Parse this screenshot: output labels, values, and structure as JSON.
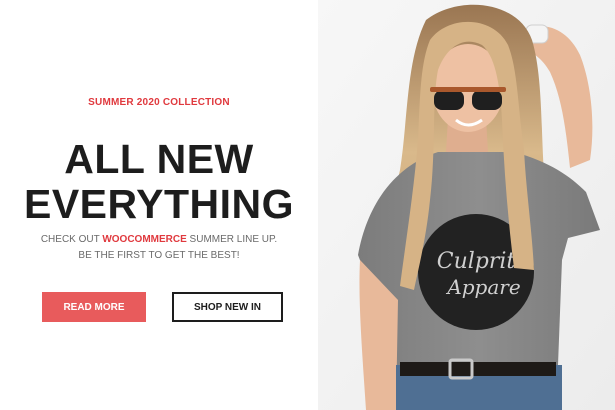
{
  "hero": {
    "eyebrow": "SUMMER 2020 COLLECTION",
    "headline_line1": "ALL NEW",
    "headline_line2": "EVERYTHING",
    "sub_part1": "CHECK OUT ",
    "sub_highlight": "WOOCOMMERCE",
    "sub_part2": " SUMMER LINE UP.",
    "sub_line2": "BE THE FIRST TO GET THE BEST!",
    "read_more": "READ MORE",
    "shop_new_in": "SHOP NEW IN"
  },
  "photo": {
    "shirt_print_line1": "Culprit",
    "shirt_print_line2": "Appare"
  },
  "colors": {
    "accent": "#e0393e",
    "button_fill": "#e85b5c",
    "heading": "#1d1d1d",
    "shirt": "#858585"
  }
}
